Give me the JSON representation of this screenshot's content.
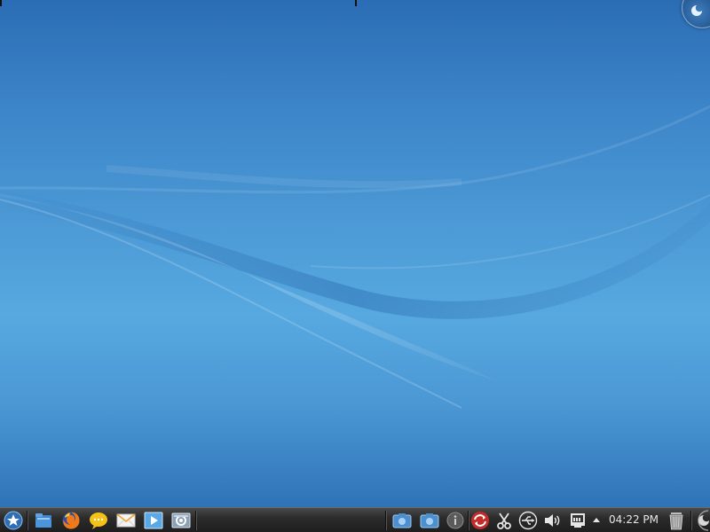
{
  "panel": {
    "launchers": [
      {
        "name": "application-launcher-icon"
      },
      {
        "name": "file-manager-icon"
      },
      {
        "name": "firefox-icon"
      },
      {
        "name": "chat-icon"
      },
      {
        "name": "mail-icon"
      },
      {
        "name": "media-player-icon"
      },
      {
        "name": "system-settings-icon"
      }
    ],
    "tray": [
      {
        "name": "screenshot-icon"
      },
      {
        "name": "screenshot-icon"
      },
      {
        "name": "info-icon"
      },
      {
        "name": "update-icon"
      },
      {
        "name": "klipper-scissors-icon"
      },
      {
        "name": "usb-device-icon"
      },
      {
        "name": "volume-icon"
      },
      {
        "name": "network-icon"
      },
      {
        "name": "tray-expand-arrow-icon"
      }
    ],
    "clock": "04:22 PM",
    "trash": "trash-icon",
    "cashew": "panel-cashew-icon"
  },
  "colors": {
    "desktop_top": "#2b6db4",
    "desktop_mid": "#57a9e0",
    "panel_bg": "#2c2c2c",
    "clock_text": "#e8e8e8"
  }
}
